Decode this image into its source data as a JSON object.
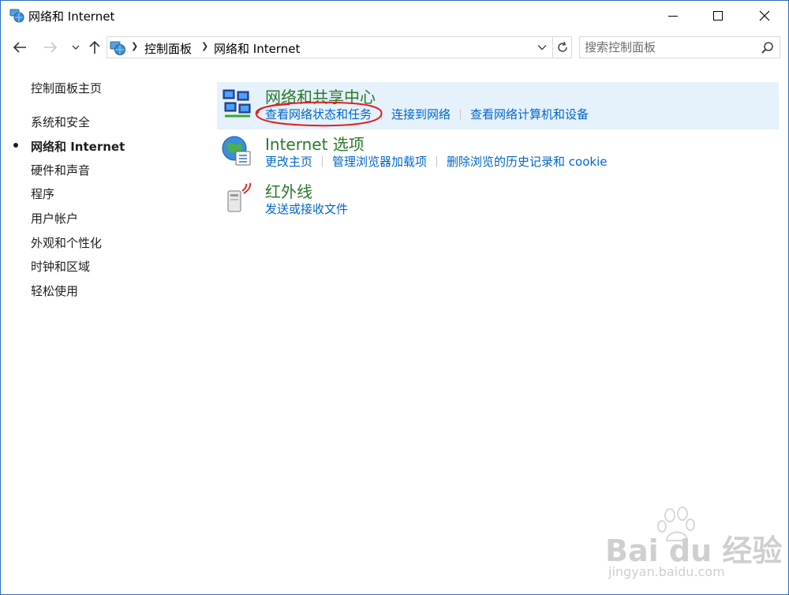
{
  "window": {
    "title": "网络和 Internet",
    "buttons": {
      "minimize": "minimize",
      "maximize": "maximize",
      "close": "close"
    }
  },
  "navigation": {
    "breadcrumb": [
      "控制面板",
      "网络和 Internet"
    ],
    "search_placeholder": "搜索控制面板"
  },
  "sidebar": {
    "home": "控制面板主页",
    "items": [
      {
        "label": "系统和安全",
        "active": false
      },
      {
        "label": "网络和 Internet",
        "active": true
      },
      {
        "label": "硬件和声音",
        "active": false
      },
      {
        "label": "程序",
        "active": false
      },
      {
        "label": "用户帐户",
        "active": false
      },
      {
        "label": "外观和个性化",
        "active": false
      },
      {
        "label": "时钟和区域",
        "active": false
      },
      {
        "label": "轻松使用",
        "active": false
      }
    ]
  },
  "categories": [
    {
      "title": "网络和共享中心",
      "icon": "network-sharing-center-icon",
      "links": [
        "查看网络状态和任务",
        "连接到网络",
        "查看网络计算机和设备"
      ]
    },
    {
      "title": "Internet 选项",
      "icon": "internet-options-globe-icon",
      "links": [
        "更改主页",
        "管理浏览器加载项",
        "删除浏览的历史记录和 cookie"
      ]
    },
    {
      "title": "红外线",
      "icon": "infrared-icon",
      "links": [
        "发送或接收文件"
      ]
    }
  ],
  "watermark": {
    "logo": "Bai du 经验",
    "url": "jingyan.baidu.com"
  },
  "colors": {
    "title_green": "#2a7a2a",
    "link_blue": "#0066cc",
    "highlight_bg": "#e5f1fb",
    "annotation_red": "#e02020"
  }
}
